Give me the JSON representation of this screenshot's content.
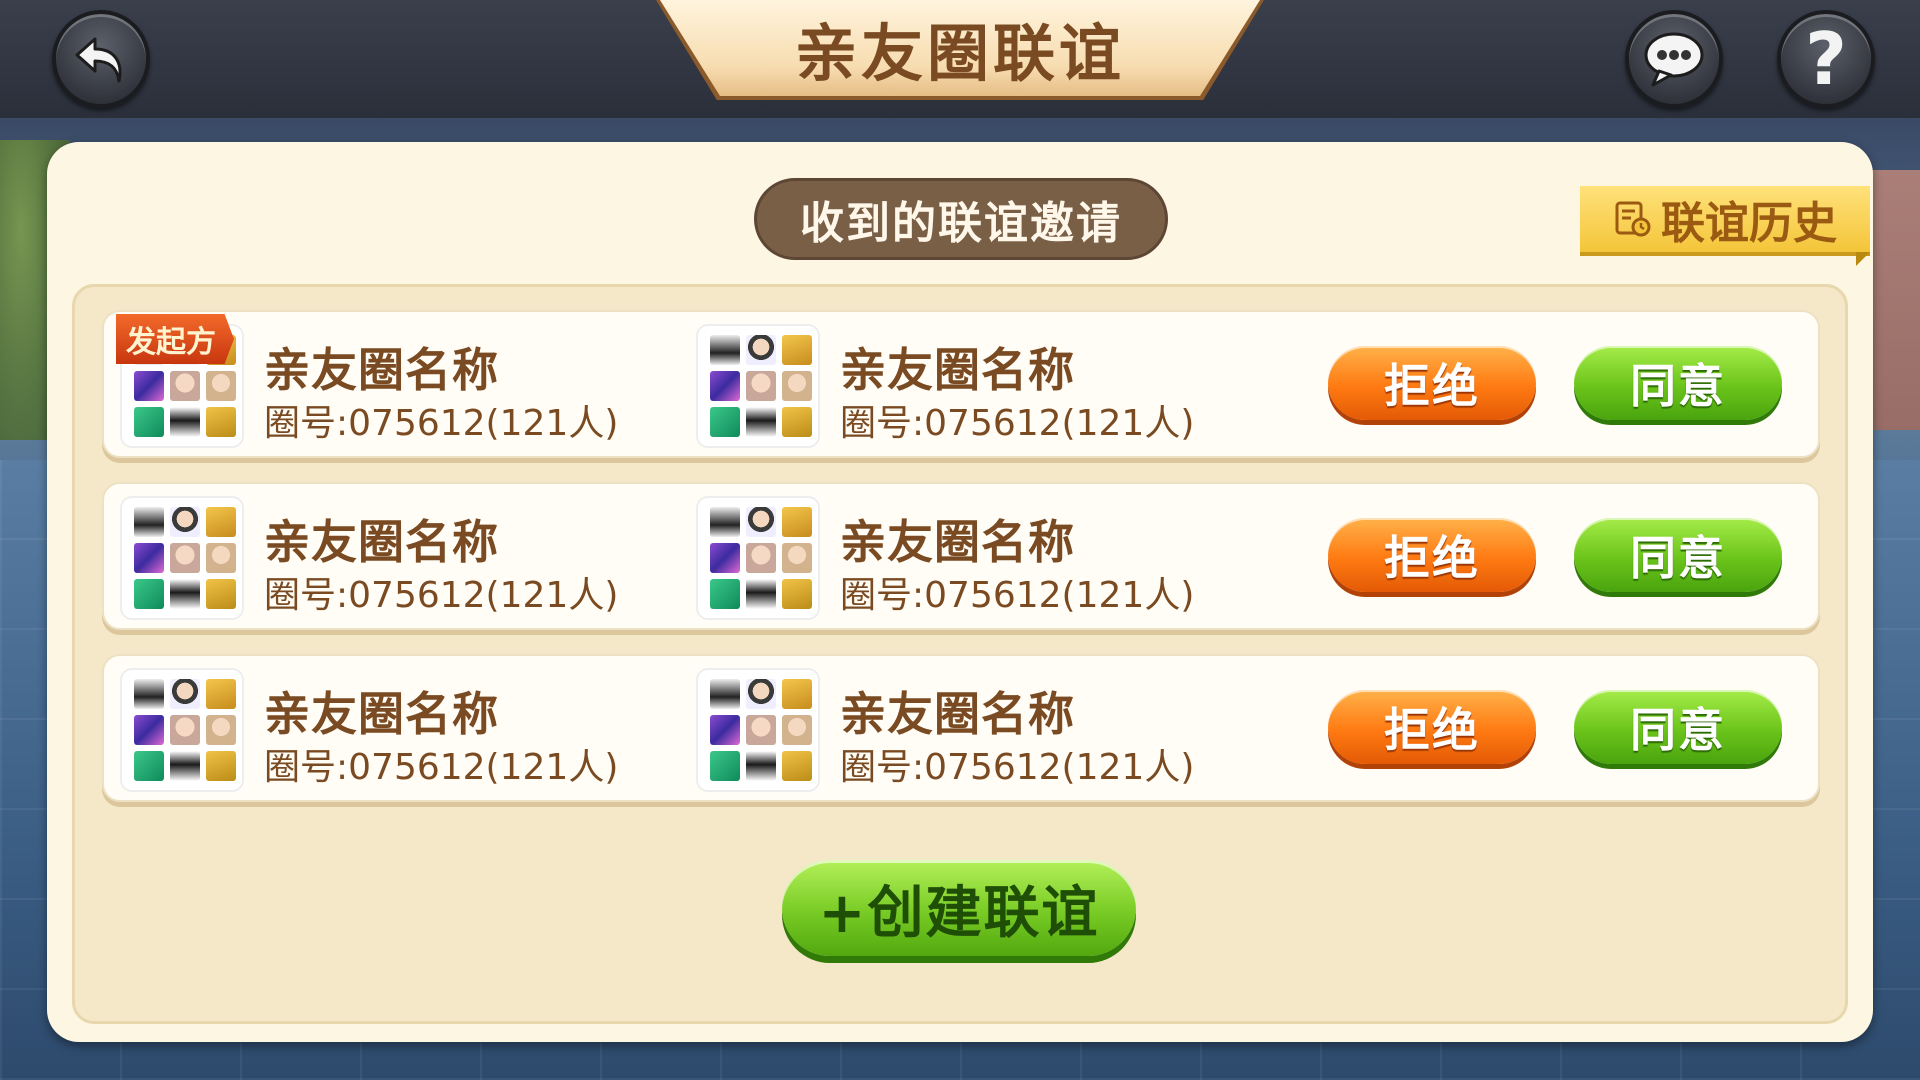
{
  "header": {
    "title": "亲友圈联谊",
    "back_icon": "back-arrow-icon",
    "chat_icon": "chat-bubble-icon",
    "help_icon": "question-mark-icon",
    "help_glyph": "?"
  },
  "panel": {
    "received_label": "收到的联谊邀请",
    "history_label": "联谊历史",
    "history_icon": "history-doc-icon"
  },
  "invites": [
    {
      "initiator_badge": "发起方",
      "left": {
        "name": "亲友圈名称",
        "id_text": "圈号:075612(121人)"
      },
      "right": {
        "name": "亲友圈名称",
        "id_text": "圈号:075612(121人)"
      },
      "reject_label": "拒绝",
      "agree_label": "同意"
    },
    {
      "left": {
        "name": "亲友圈名称",
        "id_text": "圈号:075612(121人)"
      },
      "right": {
        "name": "亲友圈名称",
        "id_text": "圈号:075612(121人)"
      },
      "reject_label": "拒绝",
      "agree_label": "同意"
    },
    {
      "left": {
        "name": "亲友圈名称",
        "id_text": "圈号:075612(121人)"
      },
      "right": {
        "name": "亲友圈名称",
        "id_text": "圈号:075612(121人)"
      },
      "reject_label": "拒绝",
      "agree_label": "同意"
    }
  ],
  "create_button": {
    "label": "+创建联谊"
  },
  "colors": {
    "title_text": "#7a4a22",
    "reject_orange": "#ff7a12",
    "agree_green": "#6bc41a",
    "history_yellow": "#f4c53a"
  }
}
